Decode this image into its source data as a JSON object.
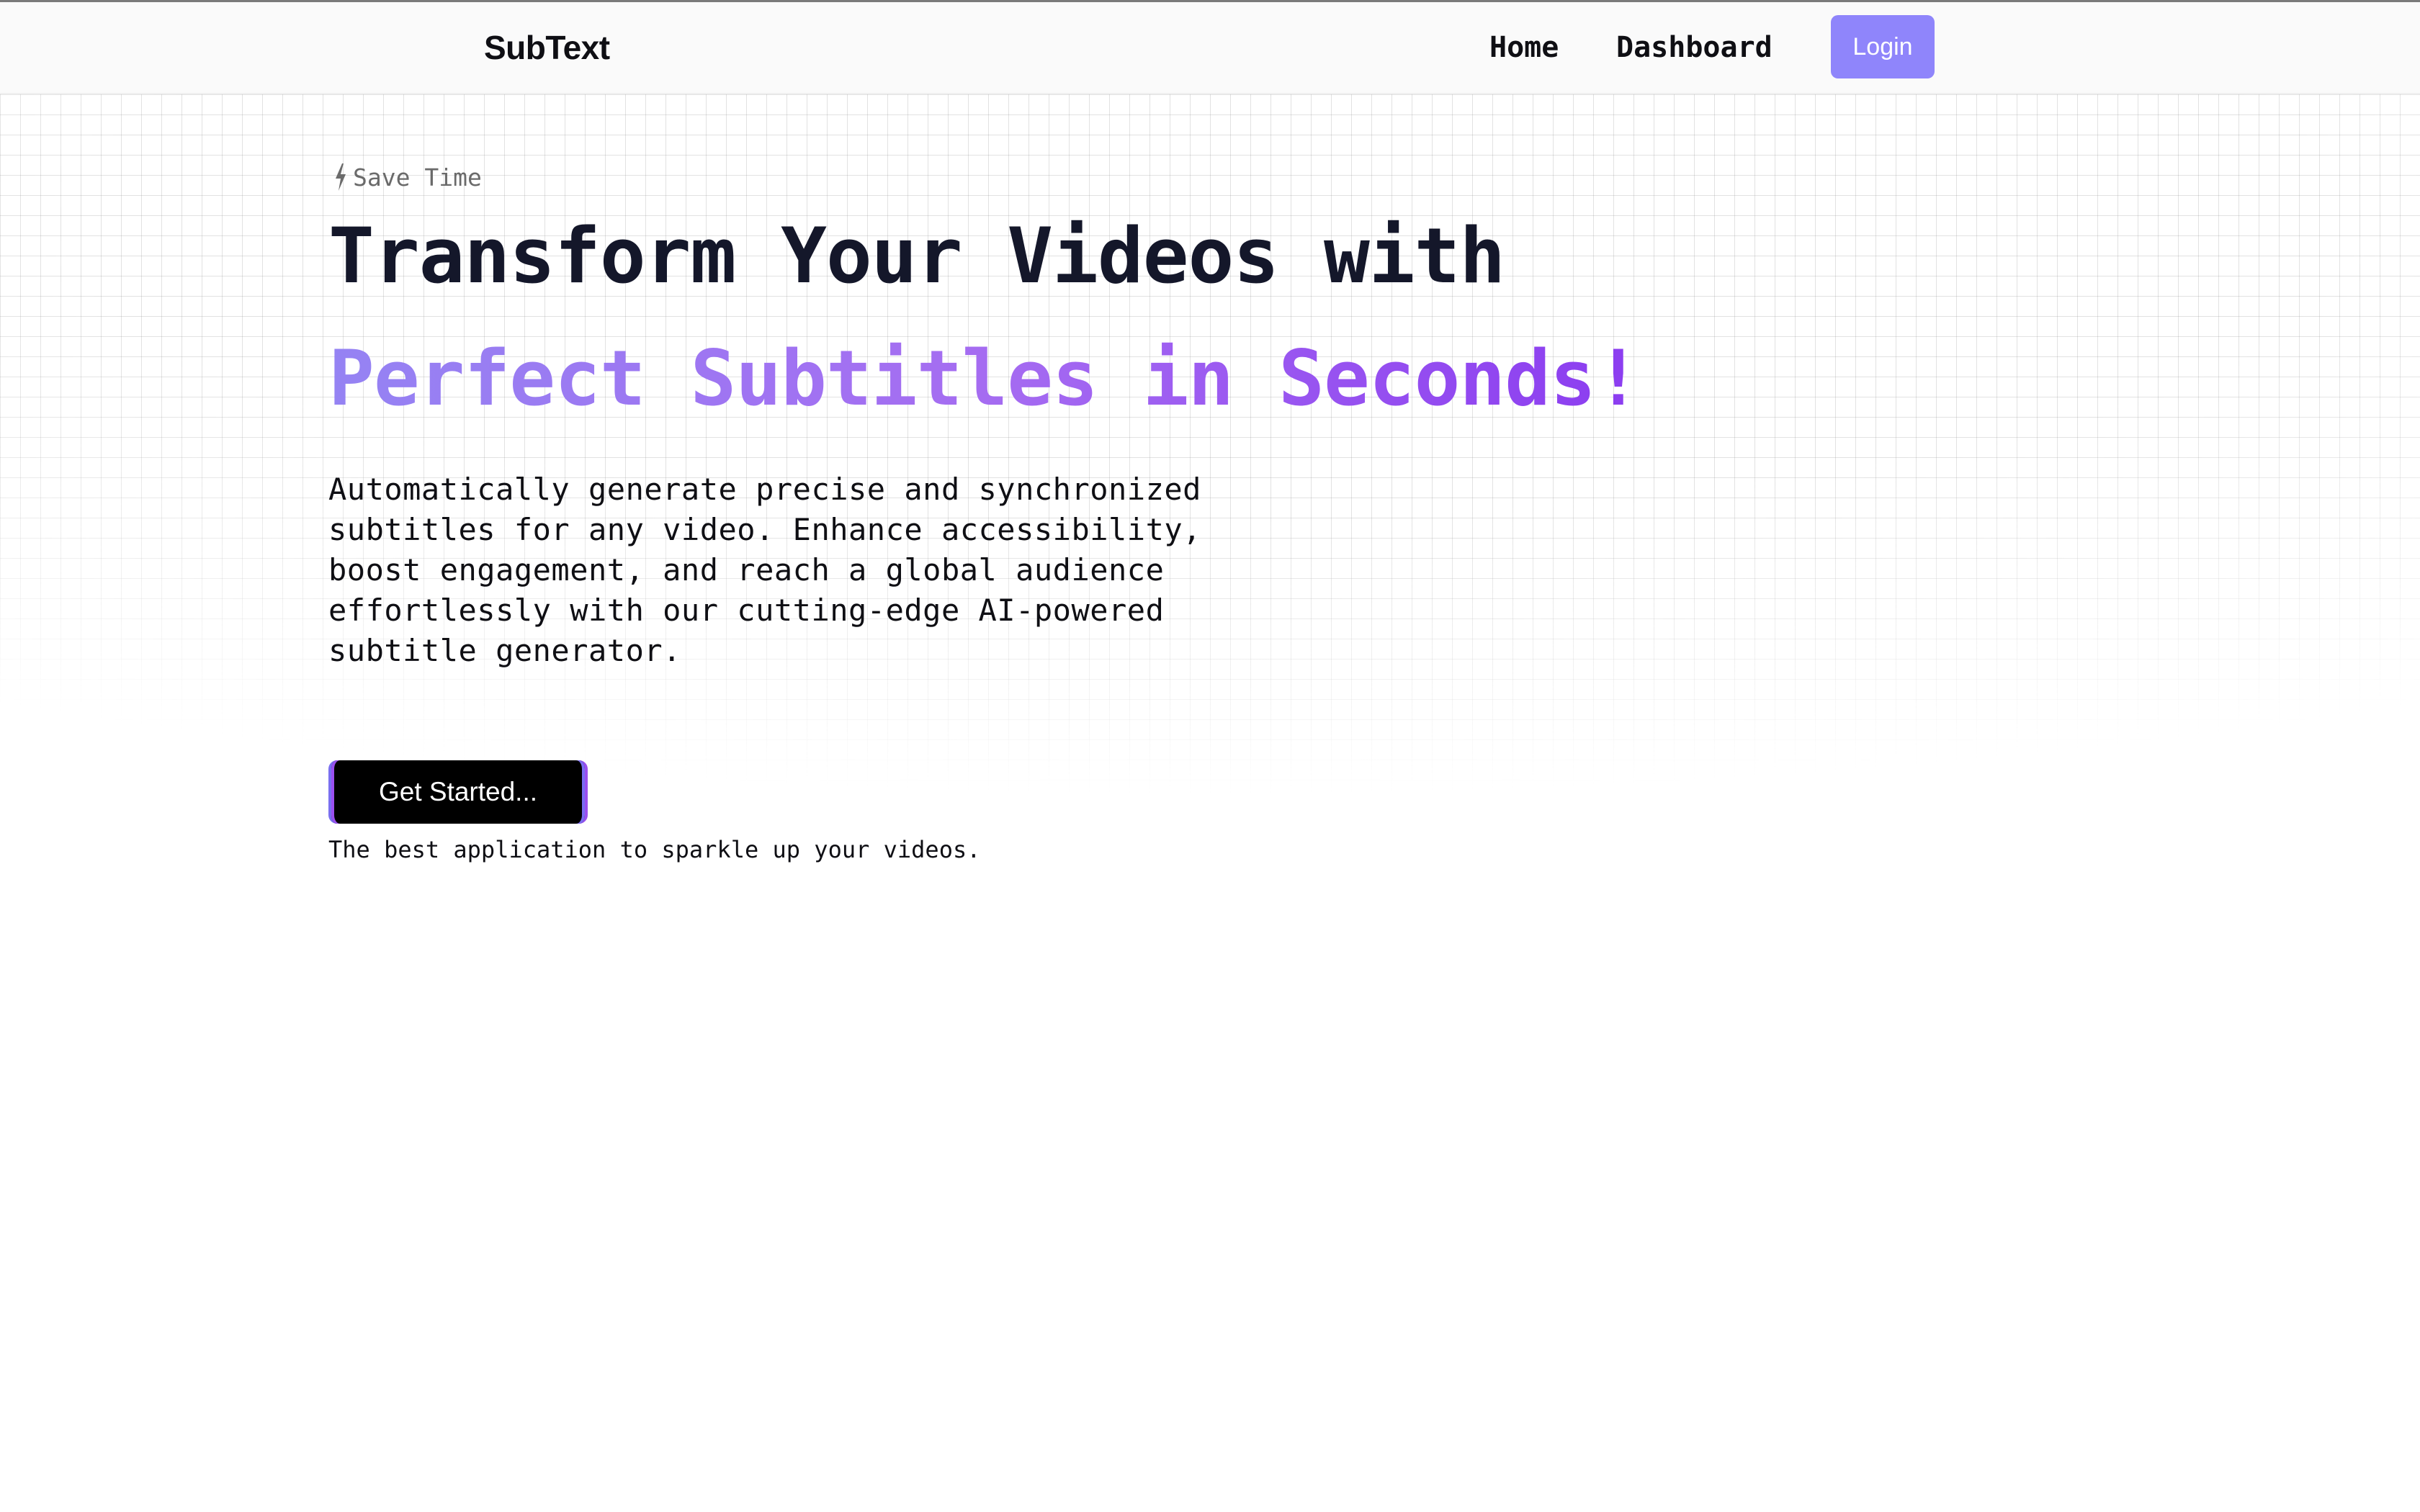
{
  "nav": {
    "brand": "SubText",
    "links": [
      {
        "label": "Home"
      },
      {
        "label": "Dashboard"
      }
    ],
    "login_label": "Login"
  },
  "hero": {
    "eyebrow": "Save Time",
    "eyebrow_icon": "bolt-icon",
    "headline": "Transform Your Videos with",
    "headline_accent": "Perfect Subtitles in Seconds!",
    "description": "Automatically generate precise and synchronized subtitles for any video. Enhance accessibility, boost engagement, and reach a global audience effortlessly with our cutting-edge AI-powered subtitle generator.",
    "cta_label": "Get Started...",
    "tagline": "The best application to sparkle up your videos."
  },
  "colors": {
    "accent_login": "#8f85fb",
    "gradient_start": "#9583f3",
    "gradient_end": "#8b3cf0",
    "cta_background": "#000000",
    "headline_text": "#14172a"
  }
}
